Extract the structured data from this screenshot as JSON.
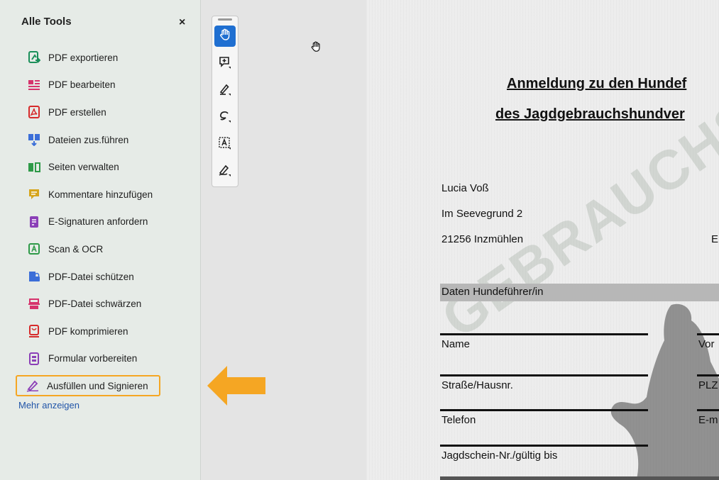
{
  "sidebar": {
    "title": "Alle Tools",
    "close_label": "×",
    "items": [
      {
        "label": "PDF exportieren",
        "icon": "pdf-export-icon",
        "color": "#1b8f5a"
      },
      {
        "label": "PDF bearbeiten",
        "icon": "pdf-edit-icon",
        "color": "#d6336c"
      },
      {
        "label": "PDF erstellen",
        "icon": "pdf-create-icon",
        "color": "#d62b2b"
      },
      {
        "label": "Dateien zus.führen",
        "icon": "combine-files-icon",
        "color": "#3b6ed8"
      },
      {
        "label": "Seiten verwalten",
        "icon": "organize-pages-icon",
        "color": "#2e9a48"
      },
      {
        "label": "Kommentare hinzufügen",
        "icon": "comment-icon",
        "color": "#d6a51c"
      },
      {
        "label": "E-Signaturen anfordern",
        "icon": "request-signature-icon",
        "color": "#8b3fb7"
      },
      {
        "label": "Scan & OCR",
        "icon": "scan-ocr-icon",
        "color": "#2e9a48"
      },
      {
        "label": "PDF-Datei schützen",
        "icon": "protect-icon",
        "color": "#3b6ed8"
      },
      {
        "label": "PDF-Datei schwärzen",
        "icon": "redact-icon",
        "color": "#d6336c"
      },
      {
        "label": "PDF komprimieren",
        "icon": "compress-icon",
        "color": "#d62b2b"
      },
      {
        "label": "Formular vorbereiten",
        "icon": "prepare-form-icon",
        "color": "#8b3fb7"
      },
      {
        "label": "Ausfüllen und Signieren",
        "icon": "fill-sign-icon",
        "color": "#8b3fb7",
        "active": true
      }
    ],
    "more_label": "Mehr anzeigen",
    "highlight_color": "#f5a623"
  },
  "toolbar": {
    "tools": [
      {
        "icon": "hand-icon",
        "selected": true
      },
      {
        "icon": "add-comment-icon",
        "selected": false
      },
      {
        "icon": "pen-icon",
        "selected": false
      },
      {
        "icon": "lasso-draw-icon",
        "selected": false
      },
      {
        "icon": "text-select-icon",
        "selected": false
      },
      {
        "icon": "sign-icon",
        "selected": false
      }
    ],
    "selected_color": "#1f6fd1"
  },
  "document": {
    "title_line1": "Anmeldung zu den Hundef",
    "title_line2": "des Jagdgebrauchshundver",
    "sender_name": "Lucia Voß",
    "sender_street": "Im Seevegrund 2",
    "sender_city": "21256 Inzmühlen",
    "right_fragment": "E",
    "section_header": "Daten Hundeführer/in",
    "watermark": "GEBRAUCHS",
    "fields": [
      {
        "label": "Name",
        "right": "Vor"
      },
      {
        "label": "Straße/Hausnr.",
        "right": "PLZ"
      },
      {
        "label": "Telefon",
        "right": "E-m"
      },
      {
        "label": "Jagdschein-Nr./gültig bis",
        "right": ""
      }
    ]
  }
}
